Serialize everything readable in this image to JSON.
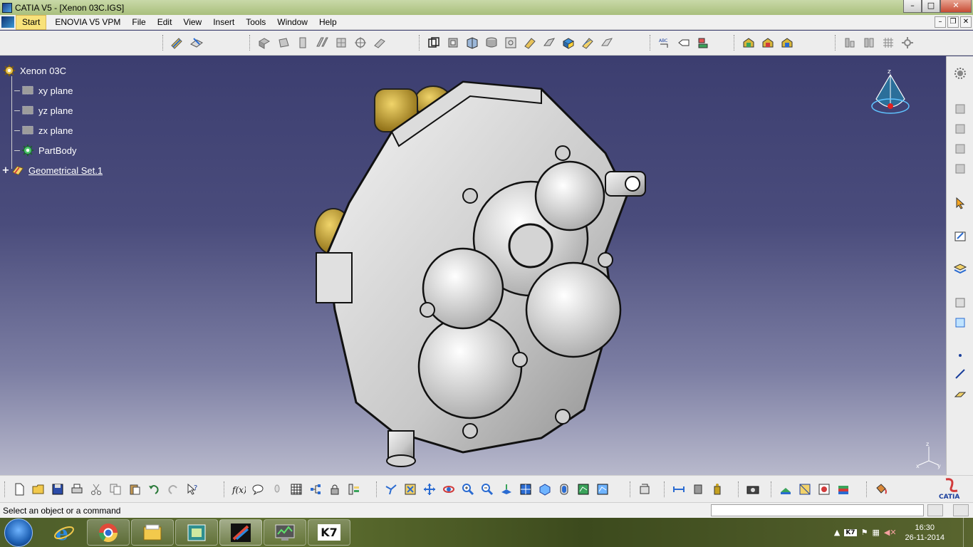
{
  "window": {
    "title": "CATIA V5 - [Xenon 03C.IGS]",
    "minimize": "–",
    "maximize": "□",
    "close": "✕"
  },
  "menu": {
    "start": "Start",
    "items": [
      "ENOVIA V5 VPM",
      "File",
      "Edit",
      "View",
      "Insert",
      "Tools",
      "Window",
      "Help"
    ],
    "mdi_min": "–",
    "mdi_restore": "❐",
    "mdi_close": "✕"
  },
  "tree": {
    "root": "Xenon 03C",
    "children": [
      {
        "label": "xy plane",
        "icon": "plane-icon"
      },
      {
        "label": "yz plane",
        "icon": "plane-icon"
      },
      {
        "label": "zx plane",
        "icon": "plane-icon"
      },
      {
        "label": "PartBody",
        "icon": "gear-icon"
      },
      {
        "label": "Geometrical Set.1",
        "icon": "geometrical-set-icon"
      }
    ],
    "expand_glyph": "+"
  },
  "compass": {
    "z_label": "z"
  },
  "axis": {
    "x": "x",
    "y": "y",
    "z": "z"
  },
  "status": {
    "message": "Select an object or a command",
    "input_value": ""
  },
  "taskbar": {
    "apps": [
      "internet-explorer-icon",
      "chrome-icon",
      "file-explorer-icon",
      "screen-app-icon",
      "catia-icon",
      "task-manager-icon",
      "k7-icon"
    ],
    "k7_label": "K7",
    "time": "16:30",
    "date": "26-11-2014"
  },
  "colors": {
    "viewport_top": "#3c3e70",
    "viewport_bottom": "#b8b9cc",
    "brass": "#b8962a"
  }
}
